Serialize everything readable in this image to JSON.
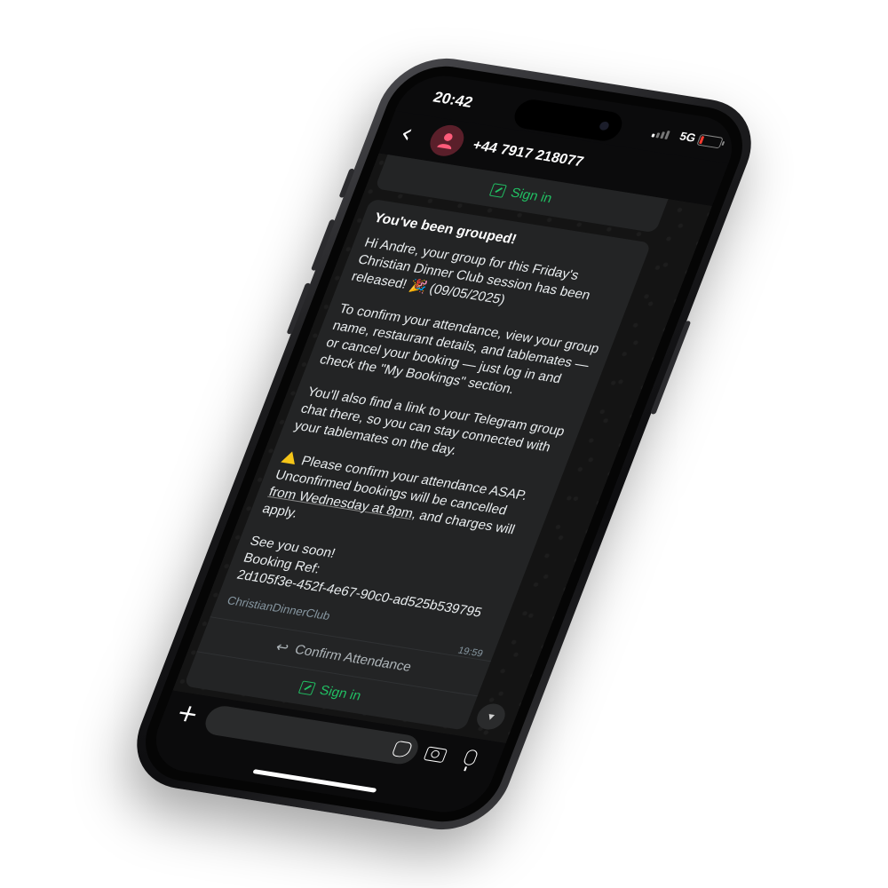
{
  "status_bar": {
    "time": "20:42",
    "network": "5G",
    "battery_level": 0.15,
    "signal_bars_active": 1
  },
  "chat_header": {
    "back_icon": "chevron-left-icon",
    "contact": "+44 7917 218077",
    "avatar_icon": "person-icon"
  },
  "previous_message": {
    "button_label": "Sign in"
  },
  "message": {
    "title": "You've been grouped!",
    "p1": "Hi Andre, your group for this Friday's Christian Dinner Club session has been released! 🎉 (09/05/2025)",
    "p2": "To confirm your attendance, view your group name, restaurant details, and tablemates — or cancel your booking — just log in and check the \"My Bookings\" section.",
    "p3": "You'll also find a link to your Telegram group chat there, so you can stay connected with your tablemates on the day.",
    "p4_start": "Please confirm your attendance ASAP. Unconfirmed bookings will be cancelled ",
    "p4_link": "from Wednesday at 8pm",
    "p4_end": ", and charges will apply.",
    "closing": "See you soon!",
    "ref_label": "Booking Ref:",
    "ref_value": "2d105f3e-452f-4e67-90c0-ad525b539795",
    "sender": "ChristianDinnerClub",
    "time": "19:59",
    "confirm_button": "Confirm Attendance",
    "signin_button": "Sign in"
  },
  "input_bar": {
    "plus_icon": "plus-icon",
    "sticker_icon": "sticker-icon",
    "camera_icon": "camera-icon",
    "mic_icon": "microphone-icon"
  },
  "colors": {
    "accent_green": "#21c063",
    "bubble_bg": "#232425",
    "warning_yellow": "#f5c518",
    "battery_red": "#ff3b30"
  }
}
